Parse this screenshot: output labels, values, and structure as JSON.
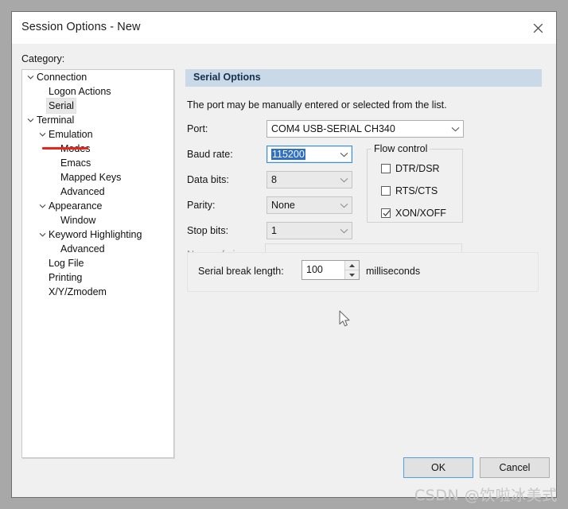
{
  "window": {
    "title": "Session Options - New",
    "close_icon": "close-icon"
  },
  "sidebar": {
    "label": "Category:",
    "items": [
      {
        "label": "Connection",
        "level": 0,
        "twisty": "chevron-down",
        "selected": false
      },
      {
        "label": "Logon Actions",
        "level": 1,
        "twisty": "none",
        "selected": false
      },
      {
        "label": "Serial",
        "level": 1,
        "twisty": "none",
        "selected": true
      },
      {
        "label": "Terminal",
        "level": 0,
        "twisty": "chevron-down",
        "selected": false
      },
      {
        "label": "Emulation",
        "level": 1,
        "twisty": "chevron-down",
        "selected": false
      },
      {
        "label": "Modes",
        "level": 2,
        "twisty": "none",
        "selected": false
      },
      {
        "label": "Emacs",
        "level": 2,
        "twisty": "none",
        "selected": false
      },
      {
        "label": "Mapped Keys",
        "level": 2,
        "twisty": "none",
        "selected": false
      },
      {
        "label": "Advanced",
        "level": 2,
        "twisty": "none",
        "selected": false
      },
      {
        "label": "Appearance",
        "level": 1,
        "twisty": "chevron-down",
        "selected": false
      },
      {
        "label": "Window",
        "level": 2,
        "twisty": "none",
        "selected": false
      },
      {
        "label": "Keyword Highlighting",
        "level": 1,
        "twisty": "chevron-down",
        "selected": false
      },
      {
        "label": "Advanced",
        "level": 2,
        "twisty": "none",
        "selected": false
      },
      {
        "label": "Log File",
        "level": 1,
        "twisty": "none",
        "selected": false
      },
      {
        "label": "Printing",
        "level": 1,
        "twisty": "none",
        "selected": false
      },
      {
        "label": "X/Y/Zmodem",
        "level": 1,
        "twisty": "none",
        "selected": false
      }
    ],
    "annotation_color": "#e8261b"
  },
  "pane": {
    "header": "Serial Options",
    "description": "The port may be manually entered or selected from the list.",
    "fields": {
      "port": {
        "label": "Port:",
        "value": "COM4 USB-SERIAL CH340",
        "disabled": false,
        "focused": false
      },
      "baud_rate": {
        "label": "Baud rate:",
        "value": "115200",
        "disabled": false,
        "focused": true
      },
      "data_bits": {
        "label": "Data bits:",
        "value": "8",
        "disabled": true,
        "focused": false
      },
      "parity": {
        "label": "Parity:",
        "value": "None",
        "disabled": true,
        "focused": false
      },
      "stop_bits": {
        "label": "Stop bits:",
        "value": "1",
        "disabled": true,
        "focused": false
      },
      "name_of_pipe": {
        "label": "Name of pipe:",
        "value": "",
        "disabled": true,
        "focused": false
      }
    },
    "flow_control": {
      "legend": "Flow control",
      "options": [
        {
          "label": "DTR/DSR",
          "checked": false
        },
        {
          "label": "RTS/CTS",
          "checked": false
        },
        {
          "label": "XON/XOFF",
          "checked": true
        }
      ]
    },
    "serial_break": {
      "label": "Serial break length:",
      "value": "100",
      "units": "milliseconds"
    }
  },
  "footer": {
    "ok_label": "OK",
    "cancel_label": "Cancel"
  },
  "overlay": {
    "watermark": "CSDN @饮啦冰美式"
  },
  "colors": {
    "header_band": "#c9d9e8",
    "focus_blue": "#3d8fd4",
    "selection_blue": "#2f6fc4",
    "annotation_red": "#e8261b",
    "dialog_bg": "#f0f0f0"
  }
}
